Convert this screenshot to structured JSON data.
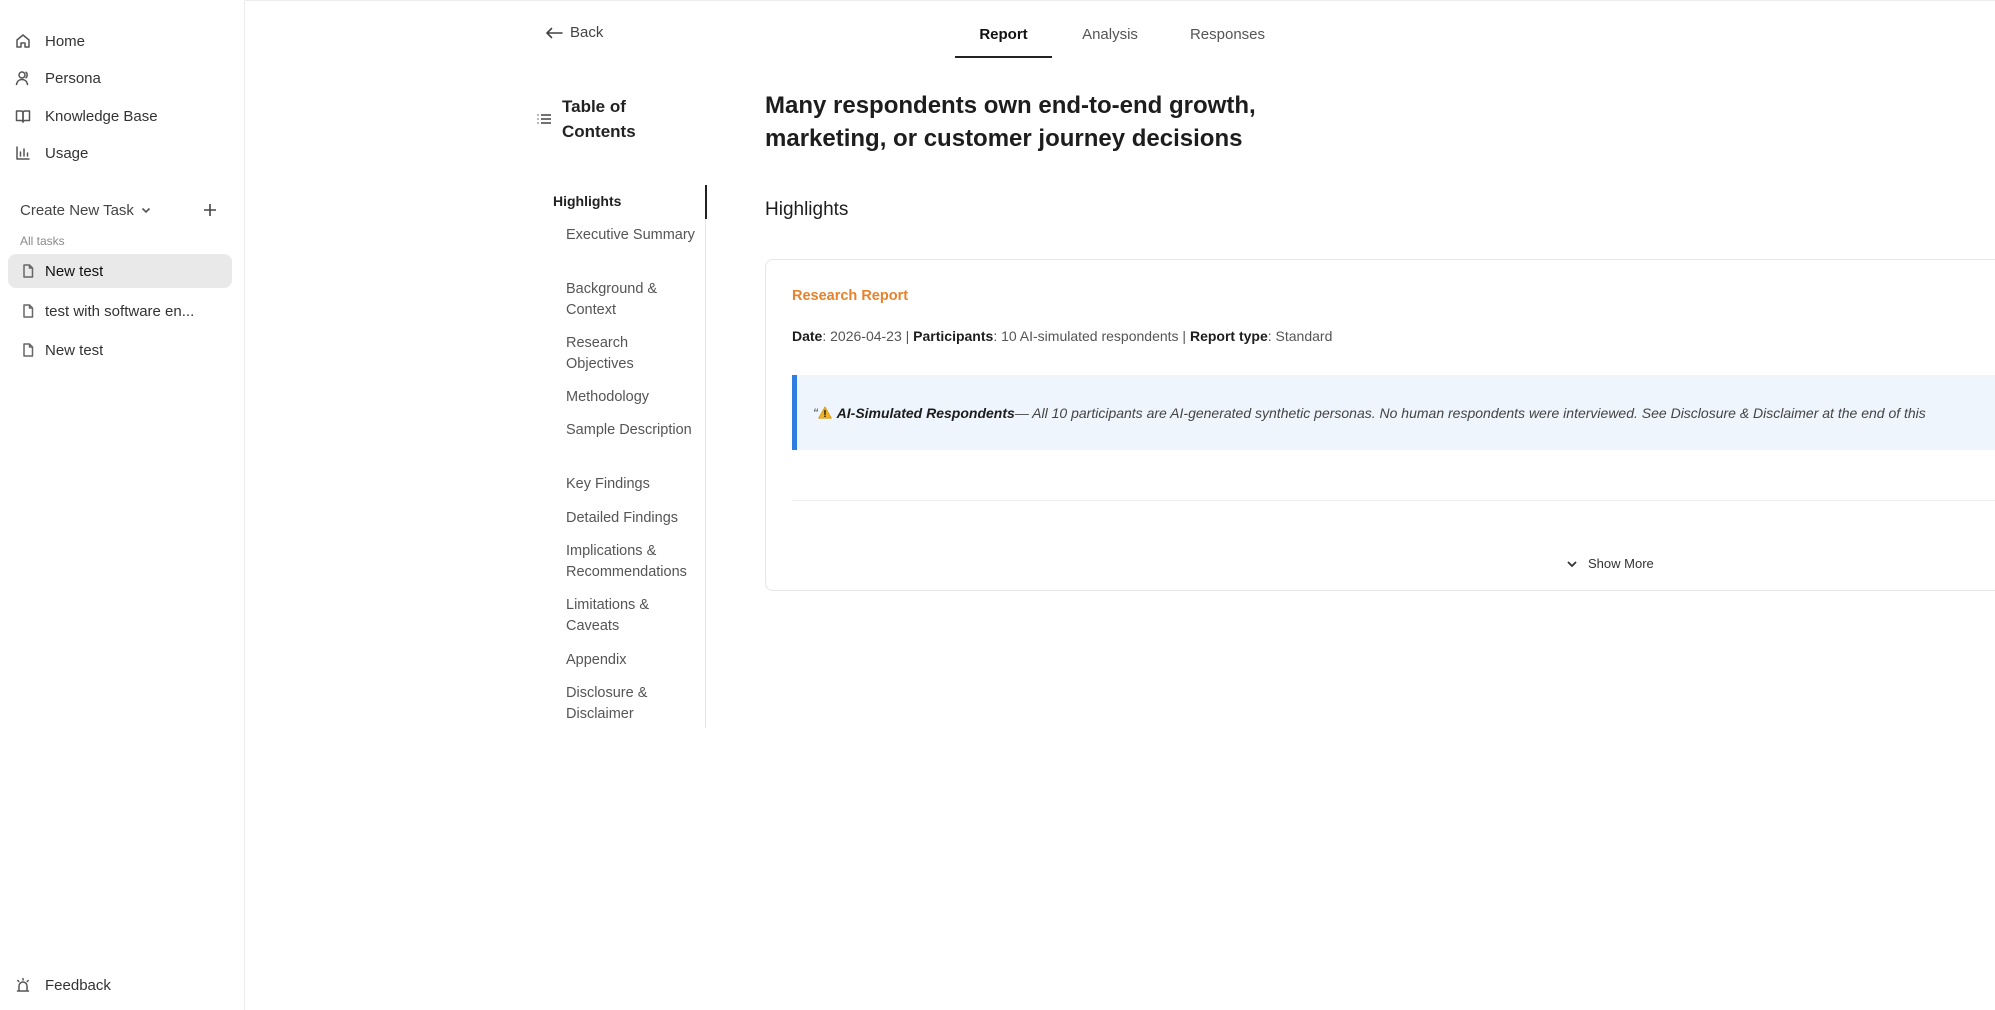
{
  "sidebar": {
    "nav": [
      {
        "label": "Home",
        "icon": "home-icon"
      },
      {
        "label": "Persona",
        "icon": "person-icon"
      },
      {
        "label": "Knowledge Base",
        "icon": "book-icon"
      },
      {
        "label": "Usage",
        "icon": "bar-chart-icon"
      }
    ],
    "create_task_label": "Create New Task",
    "all_tasks_label": "All tasks",
    "tasks": [
      {
        "label": "New test",
        "active": true
      },
      {
        "label": "test with software en..."
      },
      {
        "label": "New test"
      }
    ],
    "feedback_label": "Feedback"
  },
  "header": {
    "back_label": "Back",
    "tabs": [
      {
        "label": "Report",
        "active": true
      },
      {
        "label": "Analysis"
      },
      {
        "label": "Responses"
      }
    ]
  },
  "toc": {
    "title": "Table of Contents",
    "items": [
      "Highlights",
      "Executive Summary",
      "Background & Context",
      "Research Objectives",
      "Methodology",
      "Sample Description",
      "Key Findings",
      "Detailed Findings",
      "Implications & Recommendations",
      "Limitations & Caveats",
      "Appendix",
      "Disclosure & Disclaimer"
    ]
  },
  "main": {
    "title": "Many respondents own end-to-end growth, marketing, or customer journey decisions",
    "section_heading": "Highlights",
    "card": {
      "kicker": "Research Report",
      "meta": {
        "date_label": "Date",
        "date_value": ": 2026-04-23 | ",
        "participants_label": "Participants",
        "participants_value": ": 10 AI-simulated respondents | ",
        "report_type_label": "Report type",
        "report_type_value": ": Standard"
      },
      "callout": {
        "open_quote": "“",
        "bold": "AI-Simulated Respondents",
        "text": " — All 10 participants are AI-generated synthetic personas. No human respondents were interviewed. See Disclosure & Disclaimer at the end of this"
      },
      "show_more_label": "Show More"
    }
  },
  "colors": {
    "accent_orange": "#e8812b",
    "callout_border": "#2f7de1",
    "callout_bg": "#eef5fd",
    "active_task_bg": "#e9e9e9"
  }
}
